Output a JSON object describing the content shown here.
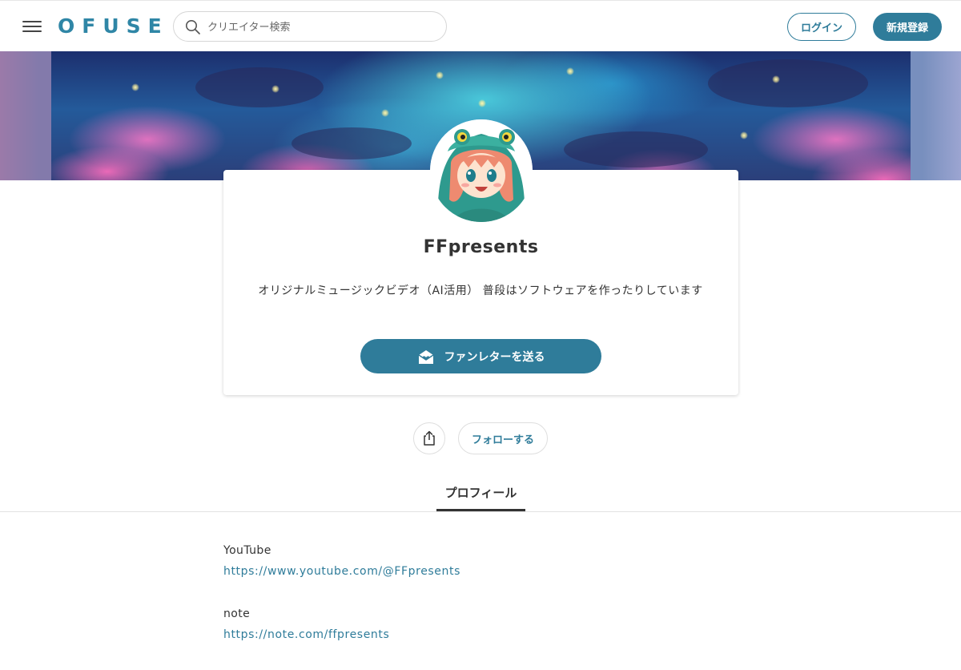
{
  "header": {
    "logo": "OFUSE",
    "search_placeholder": "クリエイター検索",
    "login_label": "ログイン",
    "register_label": "新規登録"
  },
  "profile": {
    "name": "FFpresents",
    "description": "オリジナルミュージックビデオ（AI活用） 普段はソフトウェアを作ったりしています",
    "fanletter_label": "ファンレターを送る",
    "follow_label": "フォローする"
  },
  "tabs": [
    {
      "label": "プロフィール",
      "active": true
    }
  ],
  "links": [
    {
      "label": "YouTube",
      "url": "https://www.youtube.com/@FFpresents"
    },
    {
      "label": "note",
      "url": "https://note.com/ffpresents"
    }
  ],
  "colors": {
    "accent": "#2f7c9a",
    "logo": "#2f86a6"
  },
  "icons": {
    "menu": "hamburger-icon",
    "search": "search-icon",
    "letter": "envelope-heart-icon",
    "share": "share-icon"
  }
}
